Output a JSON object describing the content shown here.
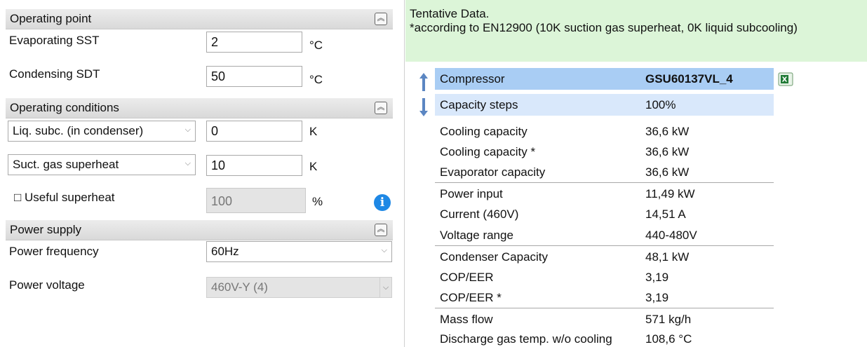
{
  "operating_point": {
    "title": "Operating point",
    "evap_label": "Evaporating SST",
    "evap_value": "2",
    "evap_unit": "°C",
    "cond_label": "Condensing SDT",
    "cond_value": "50",
    "cond_unit": "°C"
  },
  "operating_conditions": {
    "title": "Operating conditions",
    "liq_select": "Liq. subc. (in condenser)",
    "liq_value": "0",
    "liq_unit": "K",
    "suct_select": "Suct. gas superheat",
    "suct_value": "10",
    "suct_unit": "K",
    "useful_label": "□ Useful superheat",
    "useful_value": "100",
    "useful_unit": "%"
  },
  "power_supply": {
    "title": "Power supply",
    "freq_label": "Power frequency",
    "freq_value": "60Hz",
    "volt_label": "Power voltage",
    "volt_value": "460V-Y (4)"
  },
  "notice": {
    "line1": "Tentative Data.",
    "line2": "*according to EN12900 (10K suction gas superheat, 0K liquid subcooling)"
  },
  "results": {
    "compressor_label": "Compressor",
    "compressor_value": "GSU60137VL_4",
    "steps_label": "Capacity steps",
    "steps_value": "100%",
    "rows": [
      {
        "k": "Cooling capacity",
        "v": "36,6 kW"
      },
      {
        "k": "Cooling capacity *",
        "v": "36,6 kW"
      },
      {
        "k": "Evaporator capacity",
        "v": "36,6 kW"
      },
      {
        "k": "Power input",
        "v": "11,49 kW"
      },
      {
        "k": "Current (460V)",
        "v": "14,51 A"
      },
      {
        "k": "Voltage range",
        "v": "440-480V"
      },
      {
        "k": "Condenser Capacity",
        "v": "48,1 kW"
      },
      {
        "k": "COP/EER",
        "v": "3,19"
      },
      {
        "k": "COP/EER *",
        "v": "3,19"
      },
      {
        "k": "Mass flow",
        "v": "571 kg/h"
      },
      {
        "k": "Discharge gas temp. w/o cooling",
        "v": "108,6 °C"
      }
    ]
  },
  "icons": {
    "collapse": "chevron-double-up-icon",
    "info": "info-icon",
    "up": "arrow-up-icon",
    "down": "arrow-down-icon",
    "excel": "excel-icon"
  },
  "colors": {
    "header_blue": "#a9cdf4",
    "steps_blue": "#d9e8fb",
    "notice_green": "#dcf5d8",
    "info_blue": "#1e88e5"
  }
}
